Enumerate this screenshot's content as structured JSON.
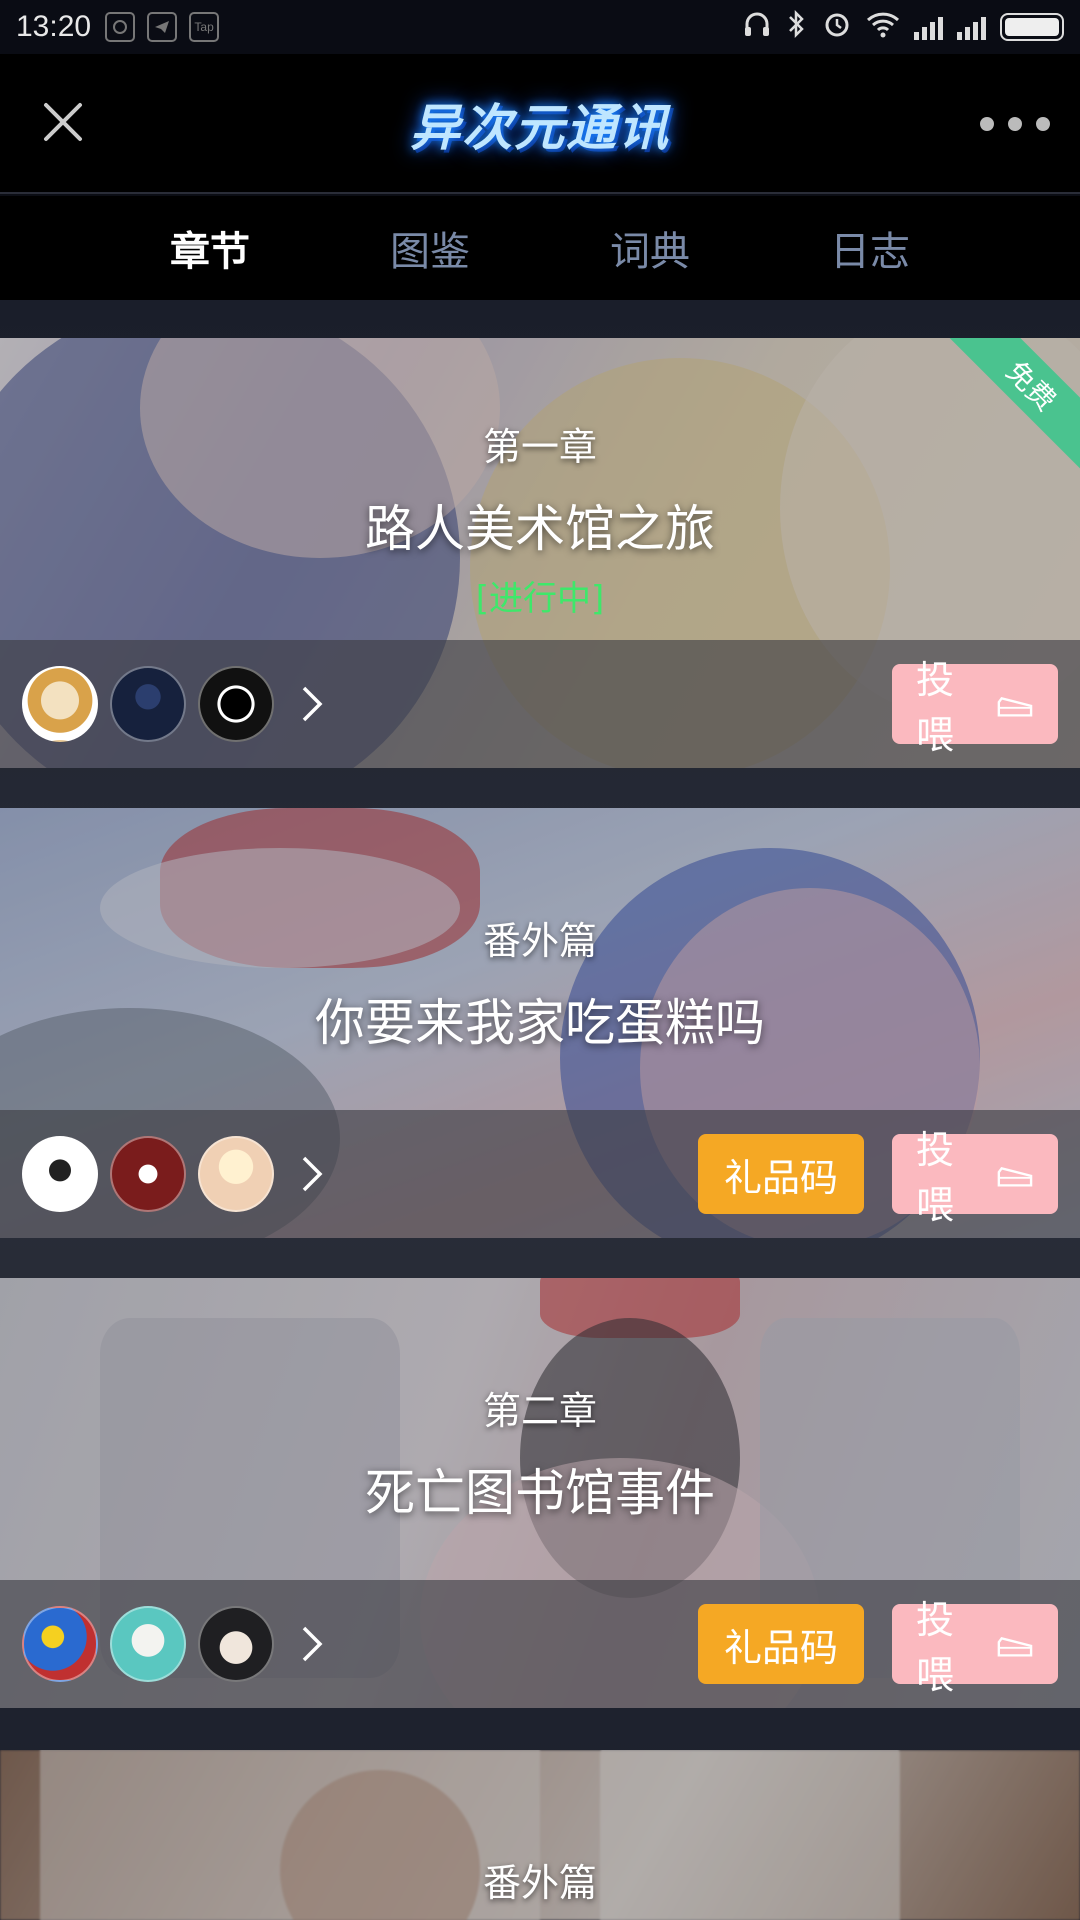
{
  "status_bar": {
    "time": "13:20",
    "left_icons": [
      "netease-icon",
      "telegram-icon",
      "taptap-icon"
    ],
    "taptap_label": "Tap",
    "right_icons": [
      "headphones-icon",
      "bluetooth-icon",
      "alarm-icon",
      "wifi-icon",
      "signal-icon",
      "signal-icon",
      "battery-icon"
    ],
    "battery_level": 1.0
  },
  "header": {
    "logo_text": "异次元通讯",
    "close_icon": "close-icon",
    "more_icon": "more-icon"
  },
  "tabs": [
    {
      "label": "章节",
      "active": true
    },
    {
      "label": "图鉴",
      "active": false
    },
    {
      "label": "词典",
      "active": false
    },
    {
      "label": "日志",
      "active": false
    }
  ],
  "cards": [
    {
      "chapter": "第一章",
      "title": "路人美术馆之旅",
      "status": "[进行中]",
      "ribbon": "免费",
      "buttons": {
        "feed": "投喂"
      }
    },
    {
      "chapter": "番外篇",
      "title": "你要来我家吃蛋糕吗",
      "buttons": {
        "gift": "礼品码",
        "feed": "投喂"
      }
    },
    {
      "chapter": "第二章",
      "title": "死亡图书馆事件",
      "buttons": {
        "gift": "礼品码",
        "feed": "投喂"
      }
    },
    {
      "chapter": "番外篇"
    }
  ],
  "colors": {
    "status_in_progress": "#3ee86a",
    "gift_button": "#f5a824",
    "feed_button": "#fbb9bf",
    "free_ribbon": "#4ac38f",
    "tab_inactive": "#7a8aa8"
  }
}
